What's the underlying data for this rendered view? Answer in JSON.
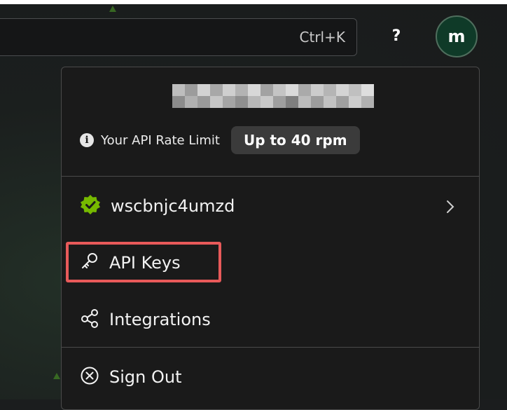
{
  "search": {
    "shortcut": "Ctrl+K"
  },
  "header": {
    "help_label": "?",
    "avatar_initial": "m"
  },
  "menu": {
    "rate_limit_label": "Your API Rate Limit",
    "rate_limit_value": "Up to 40 rpm",
    "items": [
      {
        "label": "wscbnjc4umzd",
        "icon": "verified-badge-icon"
      },
      {
        "label": "API Keys",
        "icon": "key-icon"
      },
      {
        "label": "Integrations",
        "icon": "integrations-icon"
      },
      {
        "label": "Sign Out",
        "icon": "sign-out-icon"
      }
    ]
  },
  "colors": {
    "verified_green": "#76b900",
    "highlight_red": "#e85a5a",
    "avatar_bg": "#0f3a28"
  }
}
